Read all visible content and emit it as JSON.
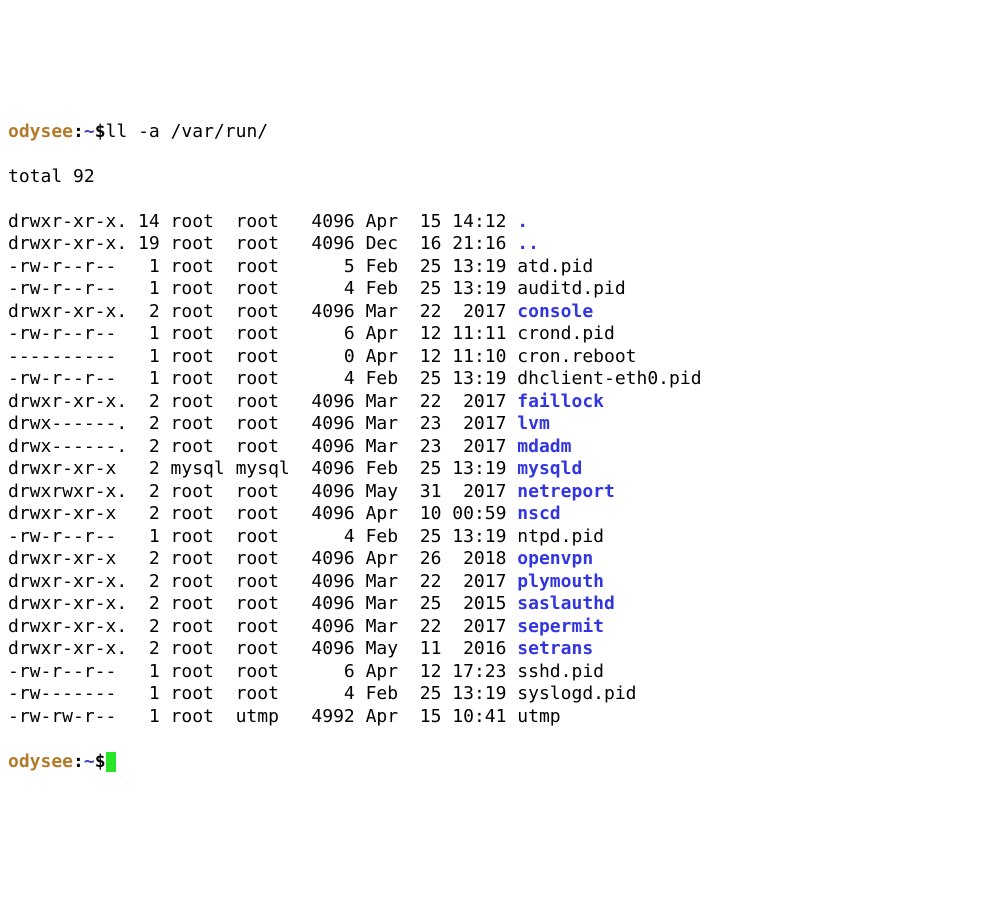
{
  "prompt": {
    "host": "odysee",
    "sep1": ":",
    "cwd": "~",
    "sep2": "$",
    "command": "ll -a /var/run/"
  },
  "total_line": "total 92",
  "rows": [
    {
      "perms": "drwxr-xr-x.",
      "links": "14",
      "owner": "root",
      "group": "root",
      "size": "4096",
      "month": "Apr",
      "day": "15",
      "time": "14:12",
      "name": ".",
      "dir": true
    },
    {
      "perms": "drwxr-xr-x.",
      "links": "19",
      "owner": "root",
      "group": "root",
      "size": "4096",
      "month": "Dec",
      "day": "16",
      "time": "21:16",
      "name": "..",
      "dir": true
    },
    {
      "perms": "-rw-r--r--",
      "links": "1",
      "owner": "root",
      "group": "root",
      "size": "5",
      "month": "Feb",
      "day": "25",
      "time": "13:19",
      "name": "atd.pid",
      "dir": false
    },
    {
      "perms": "-rw-r--r--",
      "links": "1",
      "owner": "root",
      "group": "root",
      "size": "4",
      "month": "Feb",
      "day": "25",
      "time": "13:19",
      "name": "auditd.pid",
      "dir": false
    },
    {
      "perms": "drwxr-xr-x.",
      "links": "2",
      "owner": "root",
      "group": "root",
      "size": "4096",
      "month": "Mar",
      "day": "22",
      "time": "2017",
      "name": "console",
      "dir": true
    },
    {
      "perms": "-rw-r--r--",
      "links": "1",
      "owner": "root",
      "group": "root",
      "size": "6",
      "month": "Apr",
      "day": "12",
      "time": "11:11",
      "name": "crond.pid",
      "dir": false
    },
    {
      "perms": "----------",
      "links": "1",
      "owner": "root",
      "group": "root",
      "size": "0",
      "month": "Apr",
      "day": "12",
      "time": "11:10",
      "name": "cron.reboot",
      "dir": false
    },
    {
      "perms": "-rw-r--r--",
      "links": "1",
      "owner": "root",
      "group": "root",
      "size": "4",
      "month": "Feb",
      "day": "25",
      "time": "13:19",
      "name": "dhclient-eth0.pid",
      "dir": false
    },
    {
      "perms": "drwxr-xr-x.",
      "links": "2",
      "owner": "root",
      "group": "root",
      "size": "4096",
      "month": "Mar",
      "day": "22",
      "time": "2017",
      "name": "faillock",
      "dir": true
    },
    {
      "perms": "drwx------.",
      "links": "2",
      "owner": "root",
      "group": "root",
      "size": "4096",
      "month": "Mar",
      "day": "23",
      "time": "2017",
      "name": "lvm",
      "dir": true
    },
    {
      "perms": "drwx------.",
      "links": "2",
      "owner": "root",
      "group": "root",
      "size": "4096",
      "month": "Mar",
      "day": "23",
      "time": "2017",
      "name": "mdadm",
      "dir": true
    },
    {
      "perms": "drwxr-xr-x",
      "links": "2",
      "owner": "mysql",
      "group": "mysql",
      "size": "4096",
      "month": "Feb",
      "day": "25",
      "time": "13:19",
      "name": "mysqld",
      "dir": true
    },
    {
      "perms": "drwxrwxr-x.",
      "links": "2",
      "owner": "root",
      "group": "root",
      "size": "4096",
      "month": "May",
      "day": "31",
      "time": "2017",
      "name": "netreport",
      "dir": true
    },
    {
      "perms": "drwxr-xr-x",
      "links": "2",
      "owner": "root",
      "group": "root",
      "size": "4096",
      "month": "Apr",
      "day": "10",
      "time": "00:59",
      "name": "nscd",
      "dir": true
    },
    {
      "perms": "-rw-r--r--",
      "links": "1",
      "owner": "root",
      "group": "root",
      "size": "4",
      "month": "Feb",
      "day": "25",
      "time": "13:19",
      "name": "ntpd.pid",
      "dir": false
    },
    {
      "perms": "drwxr-xr-x",
      "links": "2",
      "owner": "root",
      "group": "root",
      "size": "4096",
      "month": "Apr",
      "day": "26",
      "time": "2018",
      "name": "openvpn",
      "dir": true
    },
    {
      "perms": "drwxr-xr-x.",
      "links": "2",
      "owner": "root",
      "group": "root",
      "size": "4096",
      "month": "Mar",
      "day": "22",
      "time": "2017",
      "name": "plymouth",
      "dir": true
    },
    {
      "perms": "drwxr-xr-x.",
      "links": "2",
      "owner": "root",
      "group": "root",
      "size": "4096",
      "month": "Mar",
      "day": "25",
      "time": "2015",
      "name": "saslauthd",
      "dir": true
    },
    {
      "perms": "drwxr-xr-x.",
      "links": "2",
      "owner": "root",
      "group": "root",
      "size": "4096",
      "month": "Mar",
      "day": "22",
      "time": "2017",
      "name": "sepermit",
      "dir": true
    },
    {
      "perms": "drwxr-xr-x.",
      "links": "2",
      "owner": "root",
      "group": "root",
      "size": "4096",
      "month": "May",
      "day": "11",
      "time": "2016",
      "name": "setrans",
      "dir": true
    },
    {
      "perms": "-rw-r--r--",
      "links": "1",
      "owner": "root",
      "group": "root",
      "size": "6",
      "month": "Apr",
      "day": "12",
      "time": "17:23",
      "name": "sshd.pid",
      "dir": false
    },
    {
      "perms": "-rw-------",
      "links": "1",
      "owner": "root",
      "group": "root",
      "size": "4",
      "month": "Feb",
      "day": "25",
      "time": "13:19",
      "name": "syslogd.pid",
      "dir": false
    },
    {
      "perms": "-rw-rw-r--",
      "links": "1",
      "owner": "root",
      "group": "utmp",
      "size": "4992",
      "month": "Apr",
      "day": "15",
      "time": "10:41",
      "name": "utmp",
      "dir": false
    }
  ],
  "prompt2": {
    "host": "odysee",
    "sep1": ":",
    "cwd": "~",
    "sep2": "$"
  }
}
